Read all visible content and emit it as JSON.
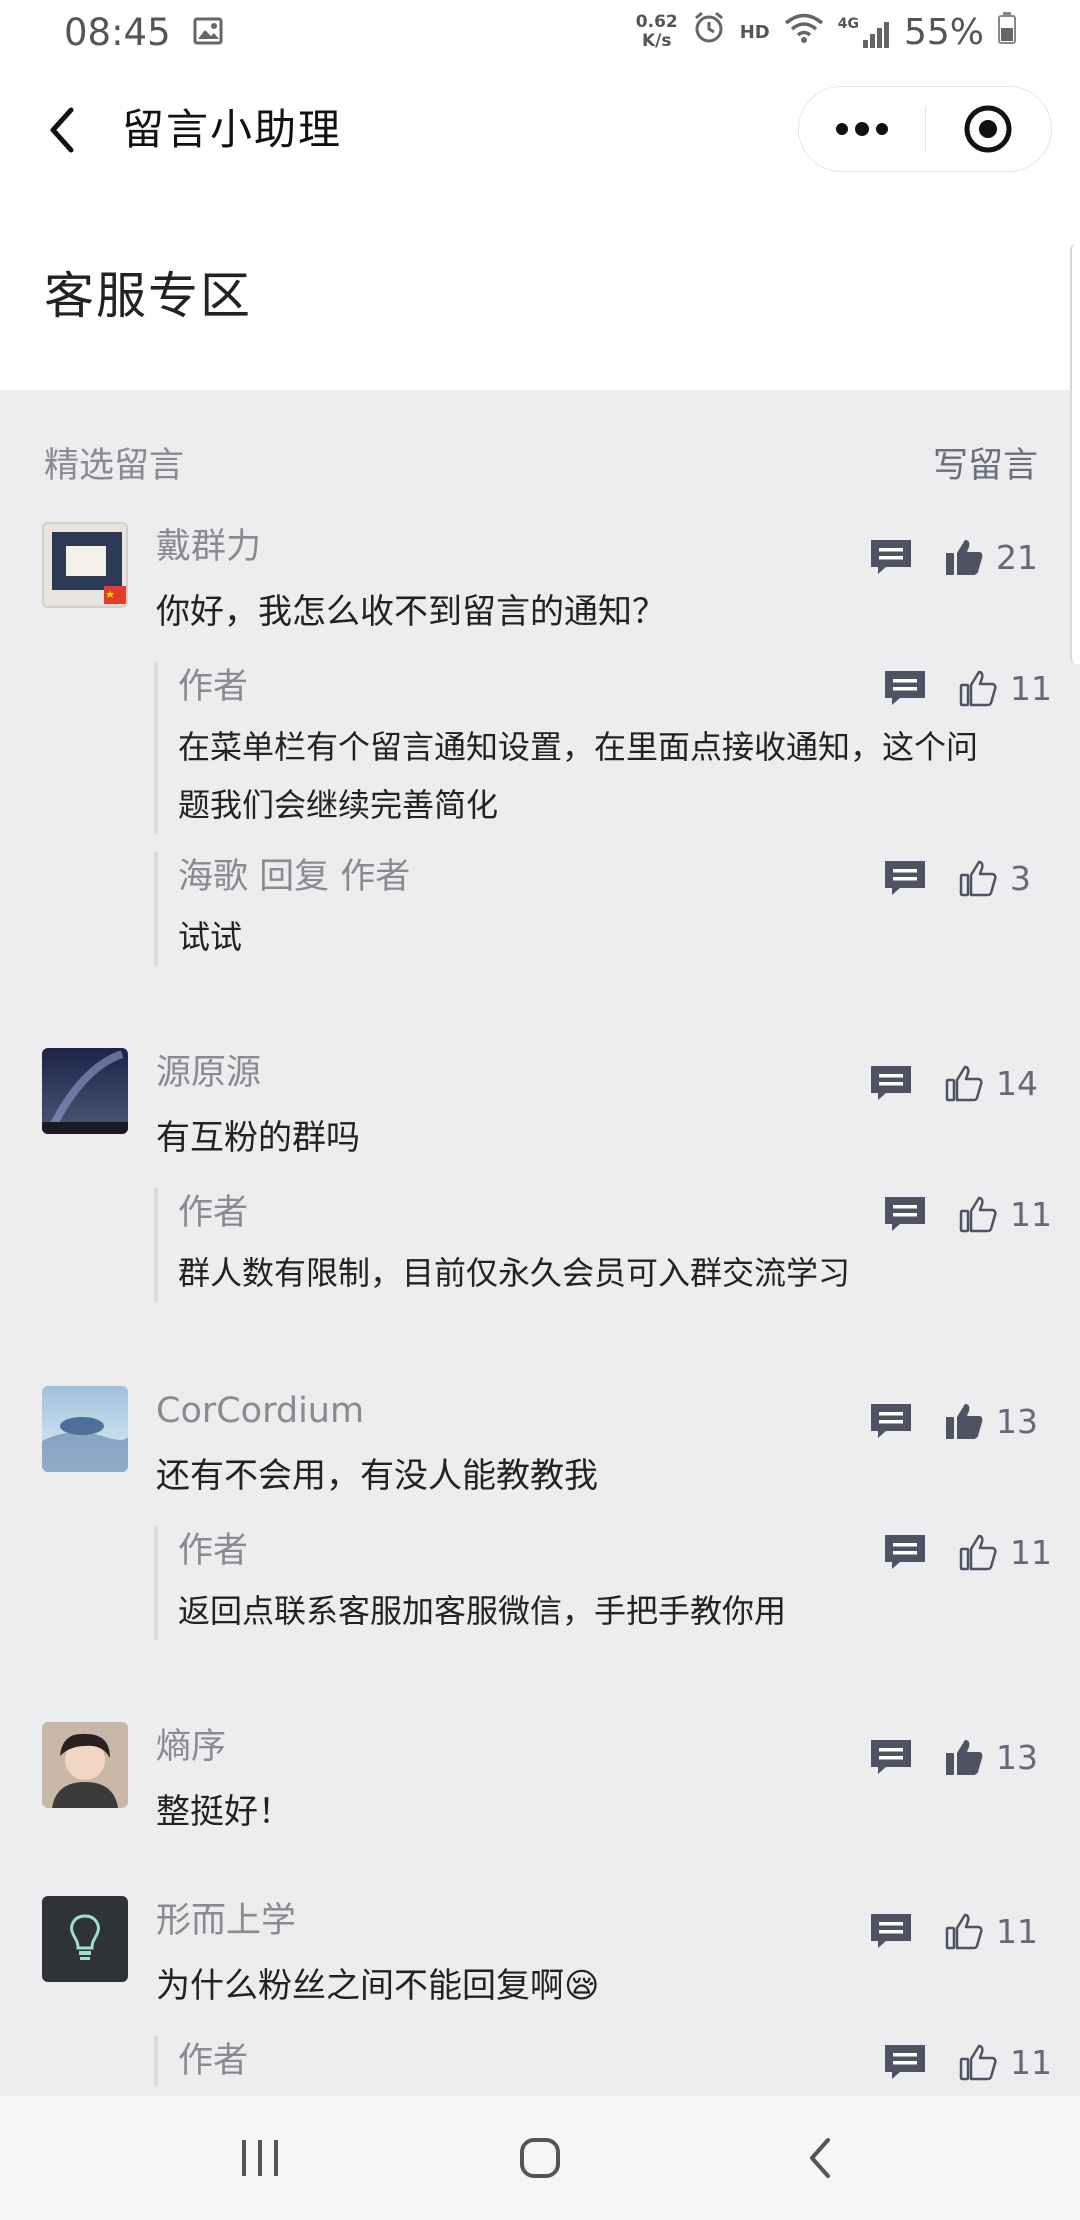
{
  "status": {
    "time": "08:45",
    "speed_top": "0.62",
    "speed_unit": "K/s",
    "hd": "HD",
    "network": "4G",
    "battery": "55%"
  },
  "nav": {
    "title": "留言小助理"
  },
  "page": {
    "title": "客服专区"
  },
  "section": {
    "featured_label": "精选留言",
    "write_label": "写留言"
  },
  "comments": [
    {
      "user": "戴群力",
      "text": "你好，我怎么收不到留言的通知？",
      "likes": "21",
      "liked": true,
      "replies": [
        {
          "name": "作者",
          "text": "在菜单栏有个留言通知设置，在里面点接收通知，这个问题我们会继续完善简化",
          "likes": "11"
        },
        {
          "name": "海歌 回复 作者",
          "text": "试试",
          "likes": "3"
        }
      ]
    },
    {
      "user": "源原源",
      "text": "有互粉的群吗",
      "likes": "14",
      "liked": false,
      "replies": [
        {
          "name": "作者",
          "text": "群人数有限制，目前仅永久会员可入群交流学习",
          "likes": "11"
        }
      ]
    },
    {
      "user": "CorCordium",
      "text": "还有不会用，有没人能教教我",
      "likes": "13",
      "liked": true,
      "replies": [
        {
          "name": "作者",
          "text": "返回点联系客服加客服微信，手把手教你用",
          "likes": "11"
        }
      ]
    },
    {
      "user": "熵序",
      "text": "整挺好！",
      "likes": "13",
      "liked": true,
      "replies": []
    },
    {
      "user": "形而上学",
      "text": "为什么粉丝之间不能回复啊😪",
      "likes": "11",
      "liked": false,
      "replies": [
        {
          "name": "作者",
          "text": "",
          "likes": "11"
        }
      ]
    }
  ],
  "colors": {
    "icon": "#4f5262",
    "background": "#ededf0",
    "accent_text": "#8a8a8f"
  }
}
